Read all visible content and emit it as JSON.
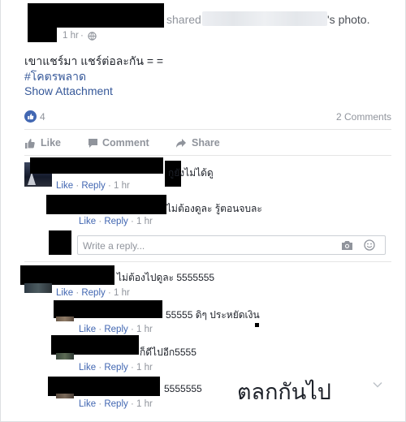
{
  "post": {
    "shared_prefix": "shared",
    "shared_suffix": "'s photo.",
    "time": "1 hr",
    "caption": "เขาแชร์มา แชร์ต่อละกัน = =",
    "hashtag": "#โคตรพลาด",
    "show_attachment": "Show Attachment",
    "like_count": "4",
    "comment_count": "2 Comments"
  },
  "actions": {
    "like": "Like",
    "comment": "Comment",
    "share": "Share"
  },
  "meta": {
    "like": "Like",
    "reply": "Reply",
    "dot": "·",
    "time": "1 hr"
  },
  "comments": [
    {
      "text": "กูยังไม่ได้ดู"
    },
    {
      "text": "ไม่ต้องดูละ รู้ตอนจบละ"
    },
    {
      "text": "ไม่ต้องไปดูละ 5555555"
    },
    {
      "text": "55555 ดิๆ ประหยัดเงิน"
    },
    {
      "text": "ก็ดีไปอีก5555"
    },
    {
      "text": "5555555"
    }
  ],
  "reply_placeholder": "Write a reply...",
  "overlay_text": "ตลกกันไป",
  "colors": {
    "link": "#365899",
    "muted": "#90949c",
    "like_blue": "#4267b2"
  }
}
